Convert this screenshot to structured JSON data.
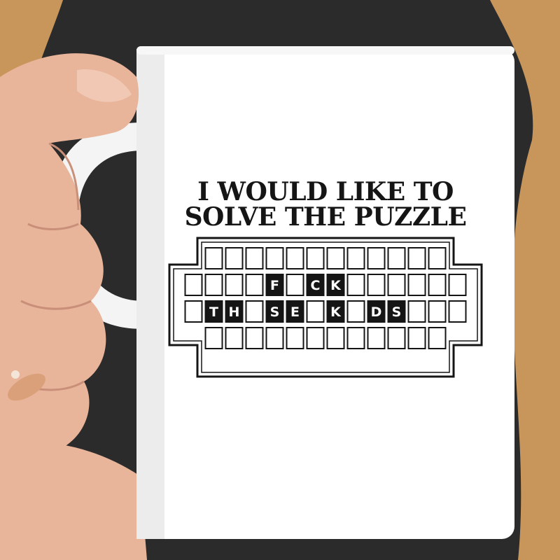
{
  "scene": {
    "background": "#2b2b2b",
    "mug_color": "#ffffff",
    "ink_color": "#151515",
    "skin_color": "#e8b49a",
    "hair_color": "#c8965a",
    "ring_color": "#d9a07a"
  },
  "print": {
    "headline_line1": "I WOULD LIKE TO",
    "headline_line2": "SOLVE THE PUZZLE",
    "board_rows": [
      {
        "count": 12,
        "letters": [
          "",
          "",
          "",
          "",
          "",
          "",
          "",
          "",
          "",
          "",
          "",
          ""
        ]
      },
      {
        "count": 14,
        "letters": [
          "",
          "",
          "",
          "",
          "F",
          "",
          "C",
          "K",
          "",
          "",
          "",
          "",
          "",
          ""
        ]
      },
      {
        "count": 14,
        "letters": [
          "",
          "T",
          "H",
          "",
          "S",
          "E",
          "",
          "K",
          "",
          "D",
          "S",
          "",
          "",
          ""
        ]
      },
      {
        "count": 12,
        "letters": [
          "",
          "",
          "",
          "",
          "",
          "",
          "",
          "",
          "",
          "",
          "",
          ""
        ]
      }
    ]
  }
}
